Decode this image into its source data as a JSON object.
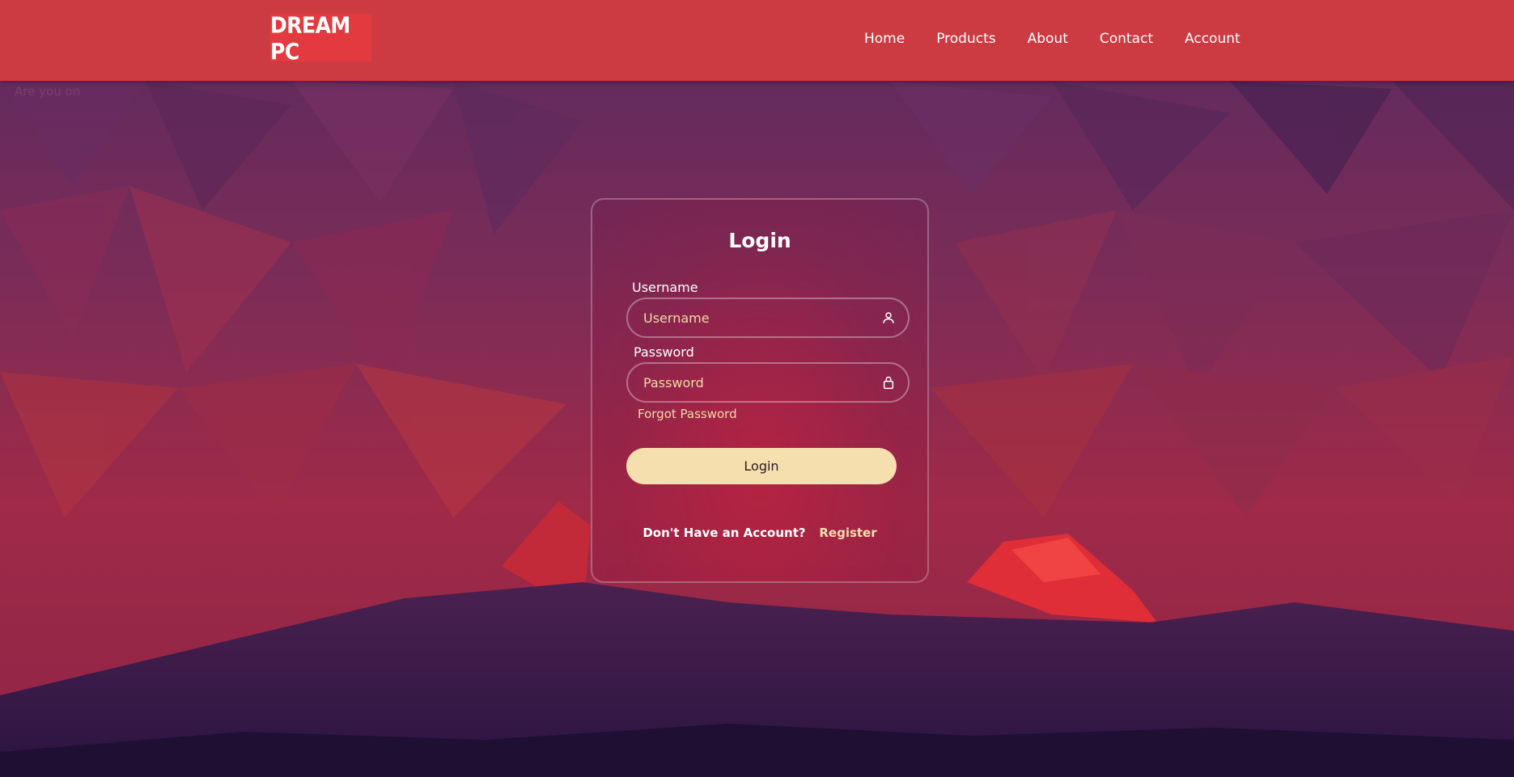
{
  "header": {
    "logo": "DREAM PC",
    "nav": [
      "Home",
      "Products",
      "About",
      "Contact",
      "Account"
    ]
  },
  "background_text": "Are you on",
  "login": {
    "title": "Login",
    "username_label": "Username",
    "username_placeholder": "Username",
    "password_label": "Password",
    "password_placeholder": "Password",
    "forgot_password": "Forgot Password",
    "login_button": "Login",
    "no_account_text": "Don't Have an Account?",
    "register_link": "Register"
  },
  "icons": {
    "username": "user-icon",
    "password": "lock-icon"
  },
  "colors": {
    "header_bg": "#cc3a42",
    "logo_bg": "#e23a3e",
    "button_bg": "#f5dfae",
    "accent_text": "#f1dba7"
  }
}
